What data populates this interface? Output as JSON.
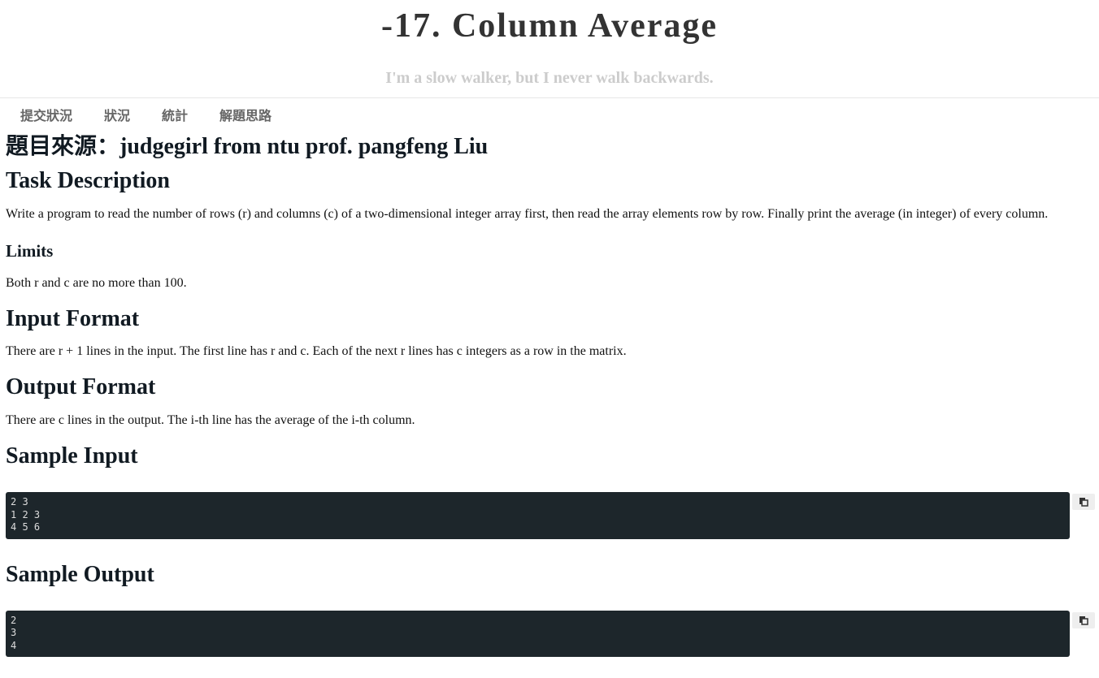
{
  "site": {
    "title": "-17. Column Average",
    "subtitle": "I'm a slow walker, but I never walk backwards."
  },
  "nav": {
    "items": [
      {
        "label": "提交狀況"
      },
      {
        "label": "狀況"
      },
      {
        "label": "統計"
      },
      {
        "label": "解題思路"
      }
    ]
  },
  "content": {
    "source_heading": "題目來源：judgegirl from ntu prof. pangfeng Liu",
    "task_heading": "Task Description",
    "task_text": "Write a program to read the number of rows (r) and columns (c) of a two-dimensional integer array first, then read the array elements row by row. Finally print the average (in integer) of every column.",
    "limits_heading": "Limits",
    "limits_text": "Both r  and c are no more than 100.",
    "input_heading": "Input Format",
    "input_text": "There are r + 1  lines in the input. The first line has r  and c. Each of the next r  lines has c integers as a row in the matrix.",
    "output_heading": "Output Format",
    "output_text": "There are c lines in the output. The i-th line has the average of the i-th column.",
    "sample_input_heading": "Sample Input",
    "sample_input_code": "2 3\n1 2 3\n4 5 6",
    "sample_output_heading": "Sample Output",
    "sample_output_code": "2\n3\n4"
  },
  "icons": {
    "copy": "clipboard-icon"
  }
}
